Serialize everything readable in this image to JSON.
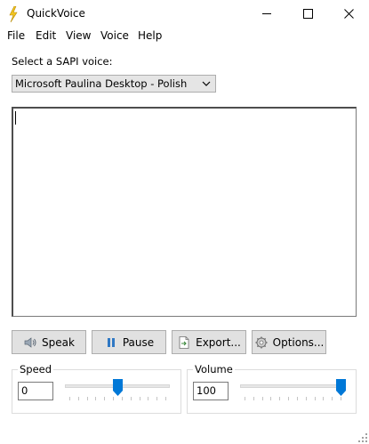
{
  "window": {
    "title": "QuickVoice",
    "controls": [
      "minimize",
      "maximize",
      "close"
    ]
  },
  "menu": [
    "File",
    "Edit",
    "View",
    "Voice",
    "Help"
  ],
  "voice": {
    "label": "Select a SAPI voice:",
    "selected": "Microsoft Paulina Desktop - Polish"
  },
  "text_area": {
    "value": ""
  },
  "buttons": {
    "speak": "Speak",
    "pause": "Pause",
    "export": "Export...",
    "options": "Options..."
  },
  "speed": {
    "label": "Speed",
    "value": "0",
    "slider_fraction": 0.5
  },
  "volume": {
    "label": "Volume",
    "value": "100",
    "slider_fraction": 1.0
  },
  "colors": {
    "accent": "#0078d7",
    "icon_yellow": "#f3c622"
  },
  "icons": {
    "app": "lightning-bolt-icon",
    "speak": "speaker-icon",
    "pause": "pause-icon",
    "export": "export-document-icon",
    "options": "gear-icon"
  }
}
